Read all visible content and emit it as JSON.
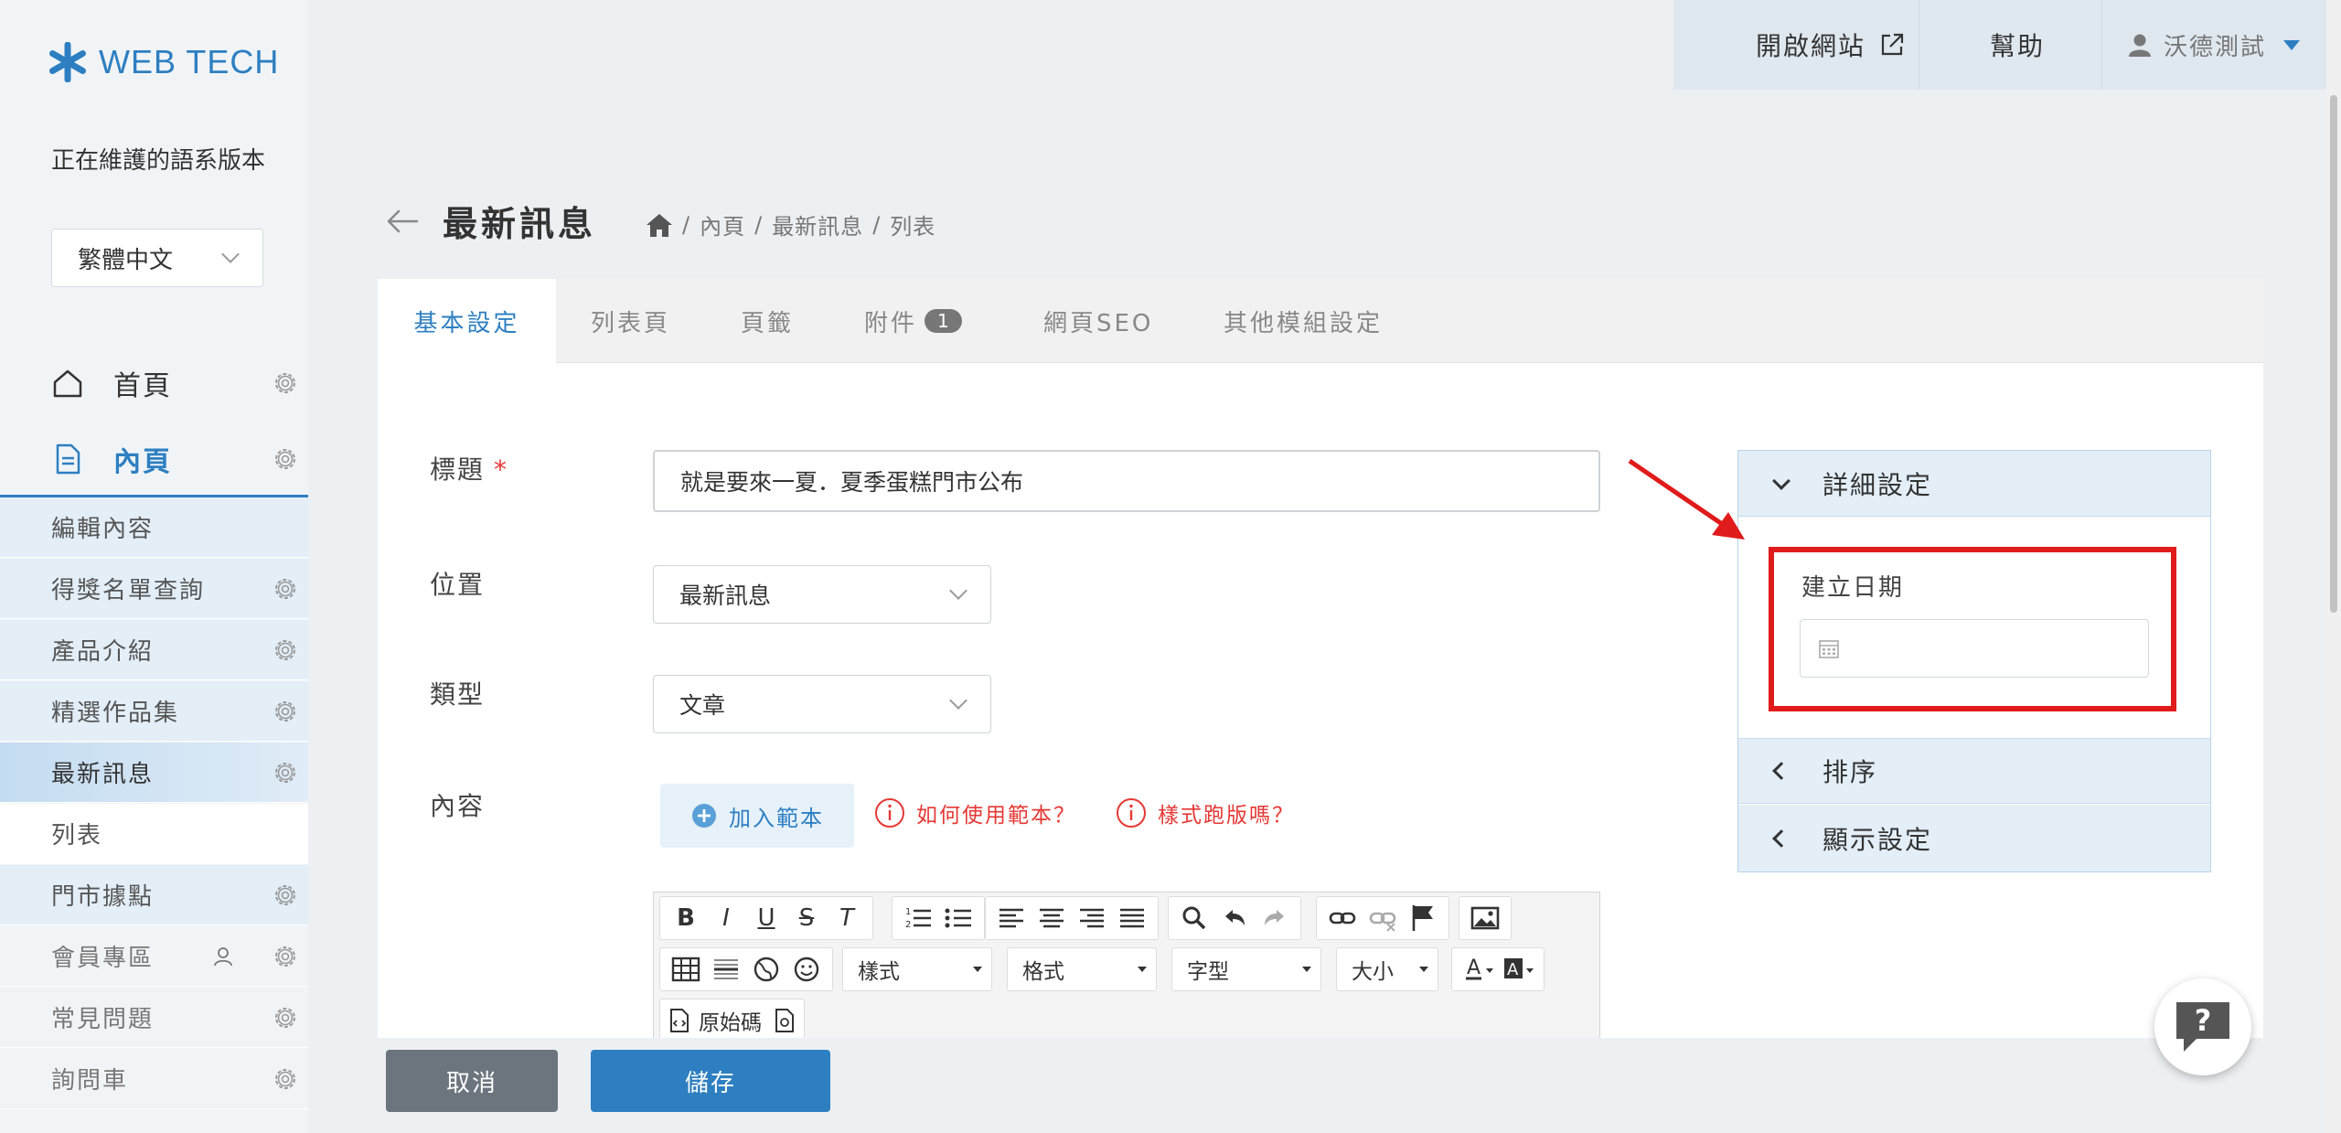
{
  "app": {
    "logo_text": "WEB TECH",
    "accent_color": "#2d7fc1",
    "alert_color": "#e53935"
  },
  "sidebar": {
    "lang_label": "正在維護的語系版本",
    "lang_value": "繁體中文",
    "home_label": "首頁",
    "inner_label": "內頁",
    "items": [
      {
        "label": "編輯內容"
      },
      {
        "label": "得獎名單查詢"
      },
      {
        "label": "產品介紹"
      },
      {
        "label": "精選作品集"
      },
      {
        "label": "最新訊息"
      },
      {
        "label": "列表"
      },
      {
        "label": "門市據點"
      },
      {
        "label": "會員專區"
      },
      {
        "label": "常見問題"
      },
      {
        "label": "詢問車"
      }
    ]
  },
  "topbar": {
    "open_site": "開啟網站",
    "help": "幫助",
    "user": "沃德測試"
  },
  "page": {
    "title": "最新訊息",
    "breadcrumb": [
      "內頁",
      "最新訊息",
      "列表"
    ]
  },
  "tabs": [
    {
      "label": "基本設定",
      "active": true
    },
    {
      "label": "列表頁"
    },
    {
      "label": "頁籤"
    },
    {
      "label": "附件",
      "badge": "1"
    },
    {
      "label": "網頁SEO"
    },
    {
      "label": "其他模組設定"
    }
  ],
  "form": {
    "title_label": "標題",
    "required_mark": "*",
    "title_value": "就是要來一夏．夏季蛋糕門市公布",
    "position_label": "位置",
    "position_value": "最新訊息",
    "type_label": "類型",
    "type_value": "文章",
    "content_label": "內容",
    "add_template": "加入範本",
    "how_to_template": "如何使用範本？",
    "style_broken": "樣式跑版嗎？"
  },
  "editor": {
    "style_combo": "樣式",
    "format_combo": "格式",
    "font_combo": "字型",
    "size_combo": "大小",
    "source_label": "原始碼"
  },
  "panel": {
    "detail_label": "詳細設定",
    "date_label": "建立日期",
    "sort_label": "排序",
    "display_label": "顯示設定"
  },
  "actions": {
    "cancel": "取消",
    "save": "儲存"
  }
}
